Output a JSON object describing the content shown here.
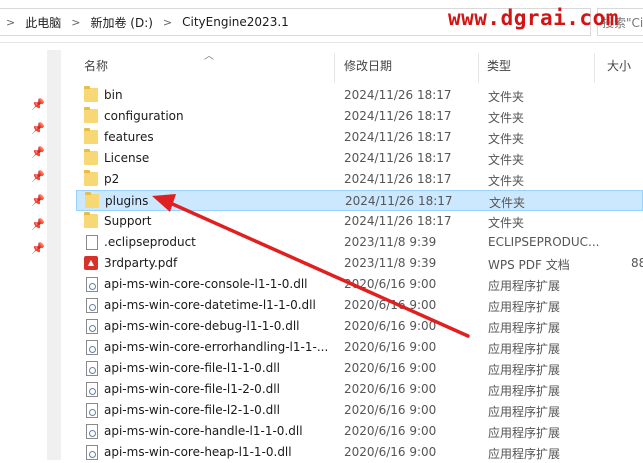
{
  "address": {
    "crumbs": [
      "此电脑",
      "新加卷 (D:)",
      "CityEngine2023.1"
    ],
    "separator": ">",
    "search_placeholder": "搜索\"Ci"
  },
  "watermark": "www.dgrai.com",
  "columns": {
    "name": "名称",
    "date": "修改日期",
    "type": "类型",
    "size": "大小"
  },
  "files": [
    {
      "name": "bin",
      "date": "2024/11/26 18:17",
      "type": "文件夹",
      "size": "",
      "icon": "folder-icon"
    },
    {
      "name": "configuration",
      "date": "2024/11/26 18:17",
      "type": "文件夹",
      "size": "",
      "icon": "folder-icon"
    },
    {
      "name": "features",
      "date": "2024/11/26 18:17",
      "type": "文件夹",
      "size": "",
      "icon": "folder-icon"
    },
    {
      "name": "License",
      "date": "2024/11/26 18:17",
      "type": "文件夹",
      "size": "",
      "icon": "folder-icon"
    },
    {
      "name": "p2",
      "date": "2024/11/26 18:17",
      "type": "文件夹",
      "size": "",
      "icon": "folder-icon"
    },
    {
      "name": "plugins",
      "date": "2024/11/26 18:17",
      "type": "文件夹",
      "size": "",
      "icon": "folder-icon",
      "selected": true
    },
    {
      "name": "Support",
      "date": "2024/11/26 18:17",
      "type": "文件夹",
      "size": "",
      "icon": "folder-icon"
    },
    {
      "name": ".eclipseproduct",
      "date": "2023/11/8 9:39",
      "type": "ECLIPSEPRODUC...",
      "size": "",
      "icon": "file-icon"
    },
    {
      "name": "3rdparty.pdf",
      "date": "2023/11/8 9:39",
      "type": "WPS PDF 文档",
      "size": "88",
      "icon": "pdf-icon"
    },
    {
      "name": "api-ms-win-core-console-l1-1-0.dll",
      "date": "2020/6/16 9:00",
      "type": "应用程序扩展",
      "size": "",
      "icon": "dll-icon"
    },
    {
      "name": "api-ms-win-core-datetime-l1-1-0.dll",
      "date": "2020/6/16 9:00",
      "type": "应用程序扩展",
      "size": "",
      "icon": "dll-icon"
    },
    {
      "name": "api-ms-win-core-debug-l1-1-0.dll",
      "date": "2020/6/16 9:00",
      "type": "应用程序扩展",
      "size": "",
      "icon": "dll-icon"
    },
    {
      "name": "api-ms-win-core-errorhandling-l1-1-...",
      "date": "2020/6/16 9:00",
      "type": "应用程序扩展",
      "size": "",
      "icon": "dll-icon"
    },
    {
      "name": "api-ms-win-core-file-l1-1-0.dll",
      "date": "2020/6/16 9:00",
      "type": "应用程序扩展",
      "size": "",
      "icon": "dll-icon"
    },
    {
      "name": "api-ms-win-core-file-l1-2-0.dll",
      "date": "2020/6/16 9:00",
      "type": "应用程序扩展",
      "size": "",
      "icon": "dll-icon"
    },
    {
      "name": "api-ms-win-core-file-l2-1-0.dll",
      "date": "2020/6/16 9:00",
      "type": "应用程序扩展",
      "size": "",
      "icon": "dll-icon"
    },
    {
      "name": "api-ms-win-core-handle-l1-1-0.dll",
      "date": "2020/6/16 9:00",
      "type": "应用程序扩展",
      "size": "",
      "icon": "dll-icon"
    },
    {
      "name": "api-ms-win-core-heap-l1-1-0.dll",
      "date": "2020/6/16 9:00",
      "type": "应用程序扩展",
      "size": "",
      "icon": "dll-icon"
    }
  ],
  "colors": {
    "selected_bg": "#cce8ff",
    "selected_border": "#99d1ff",
    "arrow": "#e02020",
    "folder": "#f8d775"
  }
}
